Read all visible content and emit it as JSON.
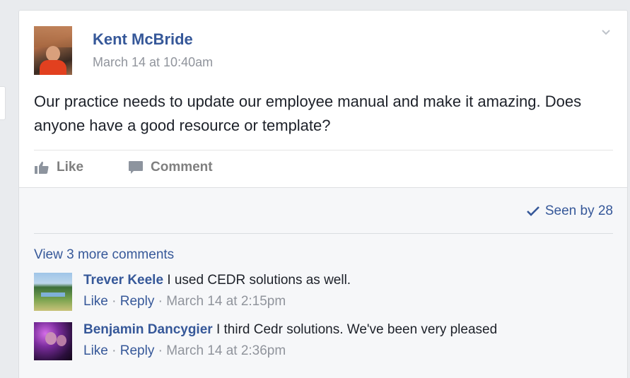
{
  "post": {
    "author": "Kent McBride",
    "timestamp": "March 14 at 10:40am",
    "text": "Our practice needs to update our employee manual and make it amazing. Does anyone have a good resource or template?",
    "actions": {
      "like": "Like",
      "comment": "Comment"
    },
    "icons": {
      "options": "chevron-down-icon",
      "like": "thumbs-up-icon",
      "comment": "speech-bubble-icon",
      "seen": "checkmark-icon"
    }
  },
  "footer": {
    "seen_by": "Seen by 28",
    "view_more": "View 3 more comments"
  },
  "comments": [
    {
      "author": "Trever Keele",
      "text": "I used CEDR solutions as well.",
      "like": "Like",
      "reply": "Reply",
      "separator": "·",
      "timestamp": "March 14 at 2:15pm"
    },
    {
      "author": "Benjamin Dancygier",
      "text": "I third Cedr solutions. We've been very pleased",
      "like": "Like",
      "reply": "Reply",
      "separator": "·",
      "timestamp": "March 14 at 2:36pm"
    }
  ],
  "colors": {
    "link": "#365899",
    "muted": "#90949c",
    "text": "#1d2129",
    "background": "#e9ebee"
  }
}
